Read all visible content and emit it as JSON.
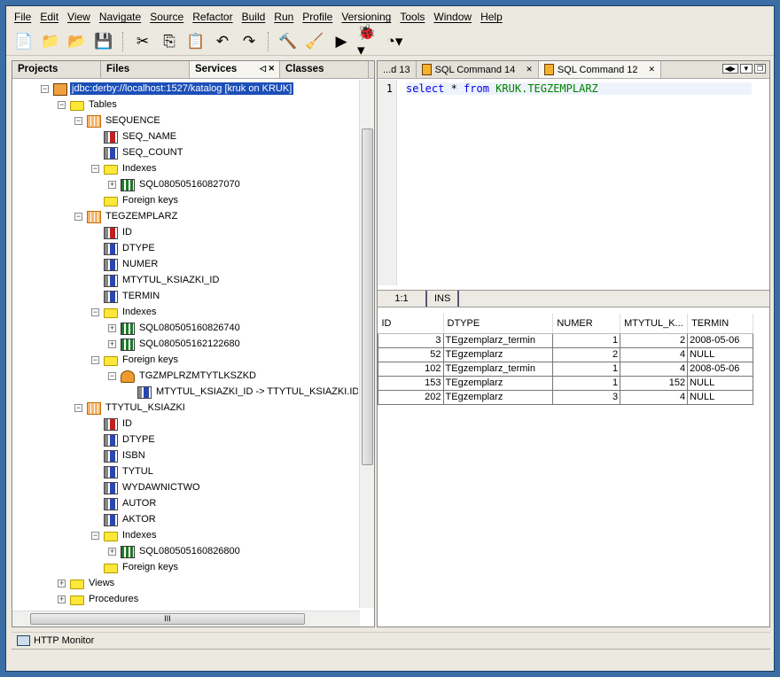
{
  "menu": [
    "File",
    "Edit",
    "View",
    "Navigate",
    "Source",
    "Refactor",
    "Build",
    "Run",
    "Profile",
    "Versioning",
    "Tools",
    "Window",
    "Help"
  ],
  "toolbar": [
    {
      "name": "new-file",
      "g": "📄"
    },
    {
      "name": "new-project",
      "g": "📁"
    },
    {
      "name": "open-project",
      "g": "📂"
    },
    {
      "name": "save-all",
      "g": "💾"
    },
    {
      "sep": true
    },
    {
      "name": "cut",
      "g": "✂"
    },
    {
      "name": "copy",
      "g": "⎘"
    },
    {
      "name": "paste",
      "g": "📋"
    },
    {
      "name": "undo",
      "g": "↶"
    },
    {
      "name": "redo",
      "g": "↷"
    },
    {
      "sep": true
    },
    {
      "name": "build",
      "g": "🔨"
    },
    {
      "name": "clean-build",
      "g": "🧹"
    },
    {
      "name": "run",
      "g": "▶"
    },
    {
      "name": "debug",
      "g": "🐞▾"
    },
    {
      "name": "profile",
      "g": "◔▾"
    }
  ],
  "left_tabs": [
    "Projects",
    "Files",
    "Services",
    "Classes"
  ],
  "active_left_tab": "Services",
  "tree": [
    {
      "label": "jdbc:derby://localhost:1527/katalog [kruk on KRUK]",
      "level": 0,
      "icon": "conn",
      "exp": "-",
      "selected": true
    },
    {
      "label": "Tables",
      "level": 1,
      "icon": "folder",
      "exp": "-"
    },
    {
      "label": "SEQUENCE",
      "level": 2,
      "icon": "table",
      "exp": "-"
    },
    {
      "label": "SEQ_NAME",
      "level": 3,
      "icon": "col pk"
    },
    {
      "label": "SEQ_COUNT",
      "level": 3,
      "icon": "col"
    },
    {
      "label": "Indexes",
      "level": 3,
      "icon": "folder",
      "exp": "-"
    },
    {
      "label": "SQL080505160827070",
      "level": 4,
      "icon": "idx",
      "exp": "+"
    },
    {
      "label": "Foreign keys",
      "level": 3,
      "icon": "folder"
    },
    {
      "label": "TEGZEMPLARZ",
      "level": 2,
      "icon": "table",
      "exp": "-"
    },
    {
      "label": "ID",
      "level": 3,
      "icon": "col pk"
    },
    {
      "label": "DTYPE",
      "level": 3,
      "icon": "col"
    },
    {
      "label": "NUMER",
      "level": 3,
      "icon": "col"
    },
    {
      "label": "MTYTUL_KSIAZKI_ID",
      "level": 3,
      "icon": "col"
    },
    {
      "label": "TERMIN",
      "level": 3,
      "icon": "col"
    },
    {
      "label": "Indexes",
      "level": 3,
      "icon": "folder",
      "exp": "-"
    },
    {
      "label": "SQL080505160826740",
      "level": 4,
      "icon": "idx",
      "exp": "+"
    },
    {
      "label": "SQL080505162122680",
      "level": 4,
      "icon": "idx",
      "exp": "+"
    },
    {
      "label": "Foreign keys",
      "level": 3,
      "icon": "folder",
      "exp": "-"
    },
    {
      "label": "TGZMPLRZMTYTLKSZKD",
      "level": 4,
      "icon": "fk",
      "exp": "-"
    },
    {
      "label": "MTYTUL_KSIAZKI_ID -> TTYTUL_KSIAZKI.ID",
      "level": 5,
      "icon": "col"
    },
    {
      "label": "TTYTUL_KSIAZKI",
      "level": 2,
      "icon": "table",
      "exp": "-"
    },
    {
      "label": "ID",
      "level": 3,
      "icon": "col pk"
    },
    {
      "label": "DTYPE",
      "level": 3,
      "icon": "col"
    },
    {
      "label": "ISBN",
      "level": 3,
      "icon": "col"
    },
    {
      "label": "TYTUL",
      "level": 3,
      "icon": "col"
    },
    {
      "label": "WYDAWNICTWO",
      "level": 3,
      "icon": "col"
    },
    {
      "label": "AUTOR",
      "level": 3,
      "icon": "col"
    },
    {
      "label": "AKTOR",
      "level": 3,
      "icon": "col"
    },
    {
      "label": "Indexes",
      "level": 3,
      "icon": "folder",
      "exp": "-"
    },
    {
      "label": "SQL080505160826800",
      "level": 4,
      "icon": "idx",
      "exp": "+"
    },
    {
      "label": "Foreign keys",
      "level": 3,
      "icon": "folder"
    },
    {
      "label": "Views",
      "level": 1,
      "icon": "folder",
      "exp": "+"
    },
    {
      "label": "Procedures",
      "level": 1,
      "icon": "folder",
      "exp": "+"
    }
  ],
  "editor_tabs": [
    {
      "label": "...d 13",
      "icon": false
    },
    {
      "label": "SQL Command 14",
      "icon": true
    },
    {
      "label": "SQL Command 12",
      "icon": true,
      "active": true
    }
  ],
  "editor": {
    "line": "1",
    "code": [
      {
        "t": "select",
        "c": "kw"
      },
      {
        "t": " * ",
        "c": ""
      },
      {
        "t": "from",
        "c": "kw"
      },
      {
        "t": " KRUK.",
        "c": "id"
      },
      {
        "t": "TEGZEMPLARZ",
        "c": "id"
      }
    ],
    "position": "1:1",
    "mode": "INS"
  },
  "results": {
    "columns": [
      "ID",
      "DTYPE",
      "NUMER",
      "MTYTUL_K...",
      "TERMIN"
    ],
    "rows": [
      [
        "3",
        "TEgzemplarz_termin",
        "1",
        "2",
        "2008-05-06"
      ],
      [
        "52",
        "TEgzemplarz",
        "2",
        "4",
        "NULL"
      ],
      [
        "102",
        "TEgzemplarz_termin",
        "1",
        "4",
        "2008-05-06"
      ],
      [
        "153",
        "TEgzemplarz",
        "1",
        "152",
        "NULL"
      ],
      [
        "202",
        "TEgzemplarz",
        "3",
        "4",
        "NULL"
      ]
    ]
  },
  "bottom": {
    "http_monitor": "HTTP Monitor"
  },
  "scroll_grip": "III"
}
